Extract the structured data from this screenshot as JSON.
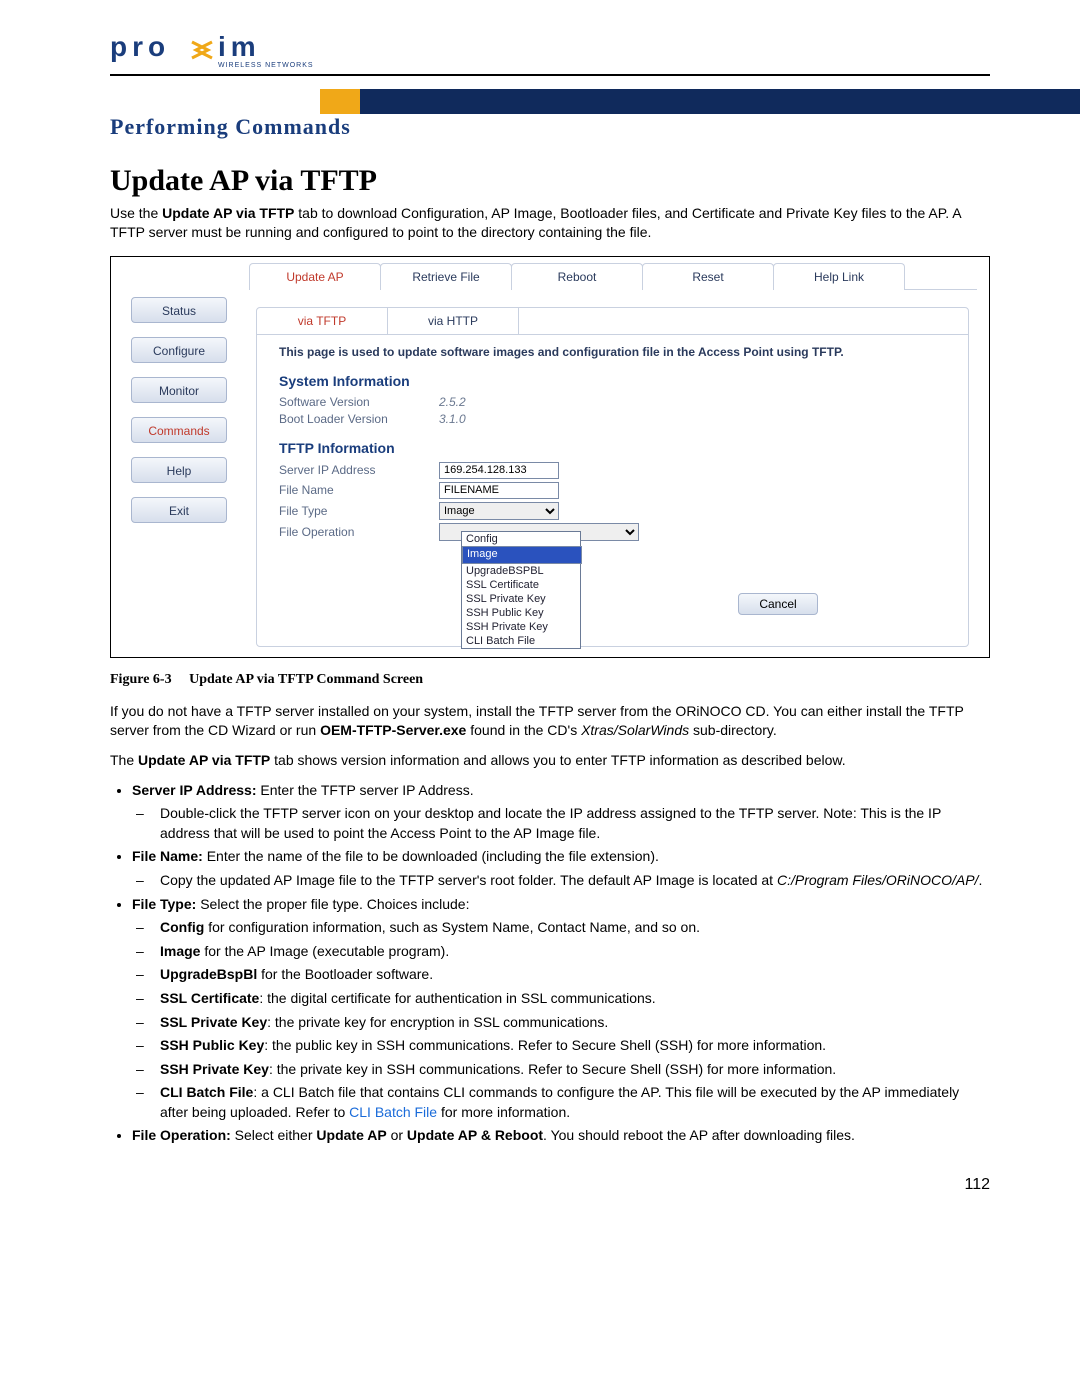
{
  "header": {
    "brand": "proxim",
    "brand_sub": "WIRELESS NETWORKS"
  },
  "section_title": "Performing Commands",
  "h1": "Update AP via TFTP",
  "intro_html": "Use the <b>Update AP via TFTP</b> tab to download Configuration, AP Image, Bootloader files, and Certificate and Private Key files to the AP. A TFTP server must be running and configured to point to the directory containing the file.",
  "figure": {
    "sidebar": [
      "Status",
      "Configure",
      "Monitor",
      "Commands",
      "Help",
      "Exit"
    ],
    "sidebar_active": "Commands",
    "top_tabs": [
      "Update AP",
      "Retrieve File",
      "Reboot",
      "Reset",
      "Help Link"
    ],
    "top_active": "Update AP",
    "sub_tabs": [
      "via TFTP",
      "via HTTP"
    ],
    "sub_active": "via TFTP",
    "note": "This page is used to update software images and configuration file in the Access Point using TFTP.",
    "sys_heading": "System Information",
    "sys": {
      "sw_label": "Software Version",
      "sw_value": "2.5.2",
      "bl_label": "Boot Loader Version",
      "bl_value": "3.1.0"
    },
    "tftp_heading": "TFTP Information",
    "tftp": {
      "ip_label": "Server IP Address",
      "ip": "169.254.128.133",
      "fname_label": "File Name",
      "fname": "FILENAME",
      "ftype_label": "File Type",
      "ftype": "Image",
      "fop_label": "File Operation",
      "fop": ""
    },
    "ftype_options": [
      "Config",
      "Image",
      "UpgradeBSPBL",
      "SSL Certificate",
      "SSL Private Key",
      "SSH Public Key",
      "SSH Private Key",
      "CLI Batch File"
    ],
    "ftype_selected": "Image",
    "cancel": "Cancel"
  },
  "caption": {
    "num": "Figure 6-3",
    "text": "Update AP via TFTP Command Screen"
  },
  "body": {
    "p1_html": "If you do not have a TFTP server installed on your system, install the TFTP server from the ORiNOCO CD. You can either install the TFTP server from the CD Wizard or run <b>OEM-TFTP-Server.exe</b> found in the CD's <em>Xtras/SolarWinds</em> sub-directory.",
    "p2_html": "The <b>Update AP via TFTP</b> tab shows version information and allows you to enter TFTP information as described below.",
    "bullets": [
      {
        "lead": "Server IP Address:",
        "text": " Enter the TFTP server IP Address.",
        "sub": [
          "Double-click the TFTP server icon on your desktop and locate the IP address assigned to the TFTP server. Note: This is the IP address that will be used to point the Access Point to the AP Image file."
        ]
      },
      {
        "lead": "File Name:",
        "text": " Enter the name of the file to be downloaded (including the file extension).",
        "sub": [
          "Copy the updated AP Image file to the TFTP server's root folder. The default AP Image is located at <em>C:/Program Files/ORiNOCO/AP/</em>."
        ]
      },
      {
        "lead": "File Type:",
        "text": " Select the proper file type. Choices include:",
        "sub": [
          "<b>Config</b> for configuration information, such as System Name, Contact Name, and so on.",
          "<b>Image</b> for the AP Image (executable program).",
          "<b>UpgradeBspBl</b> for the Bootloader software.",
          "<b>SSL Certificate</b>: the digital certificate for authentication in SSL communications.",
          "<b>SSL Private Key</b>: the private key for encryption in SSL communications.",
          "<b>SSH Public Key</b>: the public key in SSH communications. Refer to Secure Shell (SSH) for more information.",
          "<b>SSH Private Key</b>: the private key in SSH communications. Refer to Secure Shell (SSH) for more information.",
          "<b>CLI Batch File</b>: a CLI Batch file that contains CLI commands to configure the AP. This file will be executed by the AP immediately after being uploaded. Refer to <span class=\"link\">CLI Batch File</span> for more information."
        ]
      },
      {
        "lead": "File Operation:",
        "text": " Select either <b>Update AP</b> or <b>Update AP & Reboot</b>. You should reboot the AP after downloading files.",
        "sub": []
      }
    ]
  },
  "page_number": "112"
}
